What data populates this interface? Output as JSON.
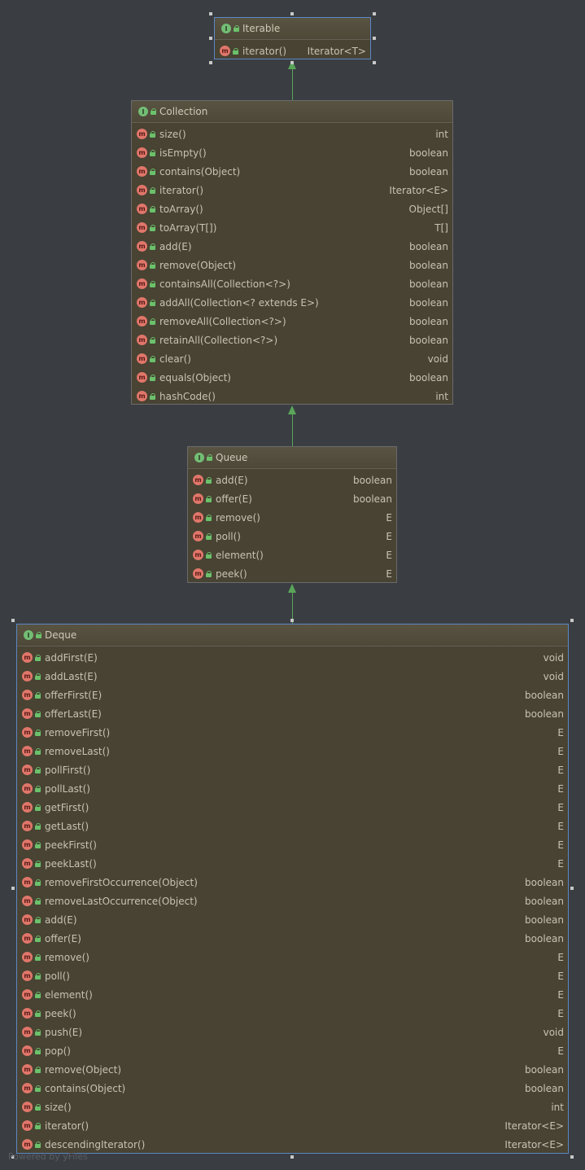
{
  "nodes": {
    "iterable": {
      "name": "Iterable",
      "methods": [
        {
          "name": "iterator()",
          "type": "Iterator<T>"
        }
      ]
    },
    "collection": {
      "name": "Collection",
      "methods": [
        {
          "name": "size()",
          "type": "int"
        },
        {
          "name": "isEmpty()",
          "type": "boolean"
        },
        {
          "name": "contains(Object)",
          "type": "boolean"
        },
        {
          "name": "iterator()",
          "type": "Iterator<E>"
        },
        {
          "name": "toArray()",
          "type": "Object[]"
        },
        {
          "name": "toArray(T[])",
          "type": "T[]"
        },
        {
          "name": "add(E)",
          "type": "boolean"
        },
        {
          "name": "remove(Object)",
          "type": "boolean"
        },
        {
          "name": "containsAll(Collection<?>)",
          "type": "boolean"
        },
        {
          "name": "addAll(Collection<? extends E>)",
          "type": "boolean"
        },
        {
          "name": "removeAll(Collection<?>)",
          "type": "boolean"
        },
        {
          "name": "retainAll(Collection<?>)",
          "type": "boolean"
        },
        {
          "name": "clear()",
          "type": "void"
        },
        {
          "name": "equals(Object)",
          "type": "boolean"
        },
        {
          "name": "hashCode()",
          "type": "int"
        }
      ]
    },
    "queue": {
      "name": "Queue",
      "methods": [
        {
          "name": "add(E)",
          "type": "boolean"
        },
        {
          "name": "offer(E)",
          "type": "boolean"
        },
        {
          "name": "remove()",
          "type": "E"
        },
        {
          "name": "poll()",
          "type": "E"
        },
        {
          "name": "element()",
          "type": "E"
        },
        {
          "name": "peek()",
          "type": "E"
        }
      ]
    },
    "deque": {
      "name": "Deque",
      "methods": [
        {
          "name": "addFirst(E)",
          "type": "void"
        },
        {
          "name": "addLast(E)",
          "type": "void"
        },
        {
          "name": "offerFirst(E)",
          "type": "boolean"
        },
        {
          "name": "offerLast(E)",
          "type": "boolean"
        },
        {
          "name": "removeFirst()",
          "type": "E"
        },
        {
          "name": "removeLast()",
          "type": "E"
        },
        {
          "name": "pollFirst()",
          "type": "E"
        },
        {
          "name": "pollLast()",
          "type": "E"
        },
        {
          "name": "getFirst()",
          "type": "E"
        },
        {
          "name": "getLast()",
          "type": "E"
        },
        {
          "name": "peekFirst()",
          "type": "E"
        },
        {
          "name": "peekLast()",
          "type": "E"
        },
        {
          "name": "removeFirstOccurrence(Object)",
          "type": "boolean"
        },
        {
          "name": "removeLastOccurrence(Object)",
          "type": "boolean"
        },
        {
          "name": "add(E)",
          "type": "boolean"
        },
        {
          "name": "offer(E)",
          "type": "boolean"
        },
        {
          "name": "remove()",
          "type": "E"
        },
        {
          "name": "poll()",
          "type": "E"
        },
        {
          "name": "element()",
          "type": "E"
        },
        {
          "name": "peek()",
          "type": "E"
        },
        {
          "name": "push(E)",
          "type": "void"
        },
        {
          "name": "pop()",
          "type": "E"
        },
        {
          "name": "remove(Object)",
          "type": "boolean"
        },
        {
          "name": "contains(Object)",
          "type": "boolean"
        },
        {
          "name": "size()",
          "type": "int"
        },
        {
          "name": "iterator()",
          "type": "Iterator<E>"
        },
        {
          "name": "descendingIterator()",
          "type": "Iterator<E>"
        }
      ]
    }
  },
  "icons": {
    "interface_badge": "I",
    "method_badge": "m"
  },
  "colors": {
    "background": "#3a3e42",
    "node_fill": "#484333",
    "edge": "#5aa55a",
    "interface_badge": "#73bd75",
    "method_badge": "#e0766a",
    "selection": "#5c87c6"
  },
  "footer": "Powered by yFiles"
}
